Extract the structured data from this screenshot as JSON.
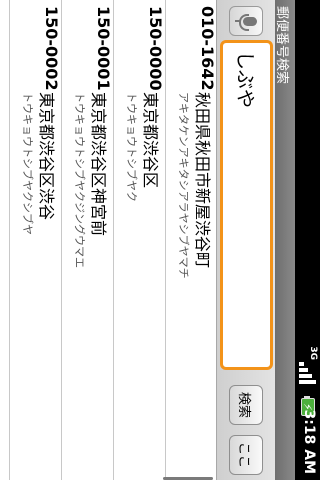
{
  "status": {
    "time": "3:18 AM",
    "network": "3G"
  },
  "app": {
    "title": "郵便番号検索"
  },
  "search": {
    "value": "しぶや"
  },
  "buttons": {
    "search": "検索",
    "here": "ここ"
  },
  "results": [
    {
      "code": "010-1642",
      "address": "秋田県秋田市新屋渋谷町",
      "kana": "アキタケンアキタシアラヤシブヤマチ"
    },
    {
      "code": "150-0000",
      "address": "東京都渋谷区",
      "kana": "トウキョウトシブヤク"
    },
    {
      "code": "150-0001",
      "address": "東京都渋谷区神宮前",
      "kana": "トウキョウトシブヤクジングウマエ"
    },
    {
      "code": "150-0002",
      "address": "東京都渋谷区渋谷",
      "kana": "トウキョウトシブヤクシブヤ"
    }
  ]
}
